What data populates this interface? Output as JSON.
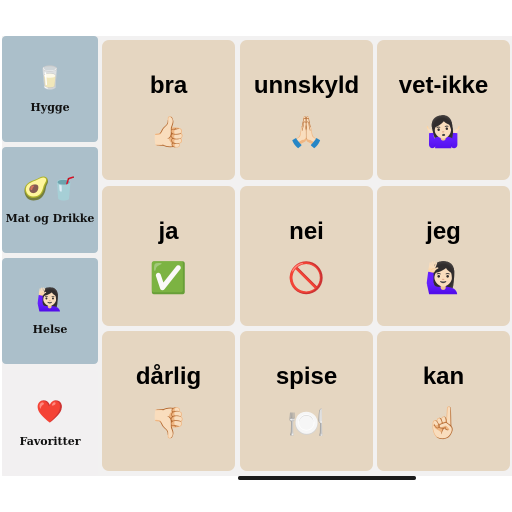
{
  "sidebar": {
    "categories": [
      {
        "label": "Hygge",
        "icon": "🥛",
        "icon_name": "drink-glass-icon"
      },
      {
        "label": "Mat og Drikke",
        "icon": "🥑🥤",
        "icon_name": "avocado-cup-icon"
      },
      {
        "label": "Helse",
        "icon": "🙋🏻‍♀️",
        "icon_name": "woman-raising-hand-icon"
      },
      {
        "label": "Favoritter",
        "icon": "❤️",
        "icon_name": "red-heart-icon"
      }
    ],
    "active": "Favoritter"
  },
  "tiles": [
    {
      "word": "bra",
      "icon": "👍🏻",
      "icon_name": "thumbs-up-icon"
    },
    {
      "word": "unnskyld",
      "icon": "🙏🏻",
      "icon_name": "folded-hands-icon"
    },
    {
      "word": "vet-ikke",
      "icon": "🤷🏻‍♀️",
      "icon_name": "woman-shrugging-icon"
    },
    {
      "word": "ja",
      "icon": "✅",
      "icon_name": "check-mark-icon"
    },
    {
      "word": "nei",
      "icon": "🚫",
      "icon_name": "prohibited-icon"
    },
    {
      "word": "jeg",
      "icon": "🙋🏻‍♀️",
      "icon_name": "woman-raising-hand-icon"
    },
    {
      "word": "dårlig",
      "icon": "👎🏻",
      "icon_name": "thumbs-down-icon"
    },
    {
      "word": "spise",
      "icon": "🍽️",
      "icon_name": "plate-cutlery-icon"
    },
    {
      "word": "kan",
      "icon": "☝🏻",
      "icon_name": "index-pointing-up-icon"
    }
  ],
  "colors": {
    "category_bg": "#abbfca",
    "category_active_bg": "#f2f0f1",
    "tile_bg": "#e5d6c1",
    "app_bg": "#f2f1f1"
  }
}
